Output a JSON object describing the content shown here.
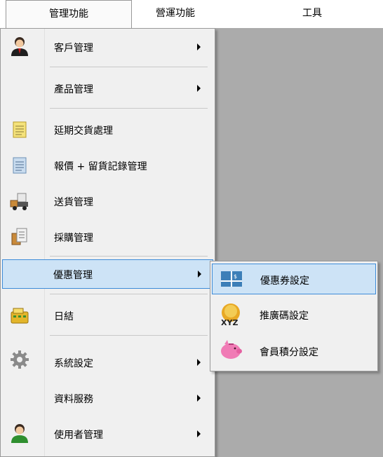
{
  "menubar": {
    "items": [
      "管理功能",
      "營運功能",
      "工具"
    ]
  },
  "main_menu": {
    "items": [
      {
        "label": "客戶管理",
        "icon": "user-icon",
        "submenu": true
      },
      {
        "label": "產品管理",
        "icon": "",
        "submenu": true
      },
      {
        "label": "延期交貨處理",
        "icon": "notepad-icon",
        "submenu": false
      },
      {
        "label": "報價 + 留貨記錄管理",
        "icon": "notepad-blue-icon",
        "submenu": false
      },
      {
        "label": "送貨管理",
        "icon": "delivery-truck-icon",
        "submenu": false
      },
      {
        "label": "採購管理",
        "icon": "purchase-documents-icon",
        "submenu": false
      },
      {
        "label": "優惠管理",
        "icon": "",
        "submenu": true,
        "highlighted": true
      },
      {
        "label": "日結",
        "icon": "cash-register-icon",
        "submenu": false
      },
      {
        "label": "系統設定",
        "icon": "gear-icon",
        "submenu": true
      },
      {
        "label": "資料服務",
        "icon": "",
        "submenu": true
      },
      {
        "label": "使用者管理",
        "icon": "user-green-icon",
        "submenu": true
      }
    ]
  },
  "sub_menu": {
    "items": [
      {
        "label": "優惠券設定",
        "icon": "coupon-icon",
        "highlighted": true
      },
      {
        "label": "推廣碼設定",
        "icon": "xyz-code-icon"
      },
      {
        "label": "會員積分設定",
        "icon": "piggy-bank-icon"
      }
    ]
  },
  "colors": {
    "highlight_bg": "#cde3f6",
    "highlight_border": "#3d8bd8",
    "menu_bg": "#f0f0f0",
    "workspace_bg": "#ababab"
  }
}
